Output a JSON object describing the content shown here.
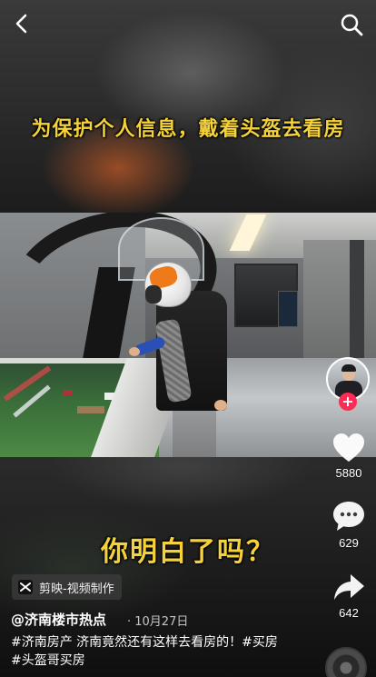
{
  "video": {
    "subtitle_top": "为保护个人信息，戴着头盔去看房",
    "subtitle_bottom": "你明白了吗？"
  },
  "header": {
    "back_icon": "back-chevron-icon",
    "search_icon": "search-icon"
  },
  "rail": {
    "avatar_icon": "avatar",
    "follow_icon": "plus-icon",
    "like_count": "5880",
    "comment_count": "629",
    "share_count": "642",
    "like_color": "#ffffff",
    "follow_color": "#fe2c55"
  },
  "info": {
    "capcut_label": "剪映-视频制作",
    "author": "@济南楼市热点",
    "date": "· 10月27日",
    "caption": "#济南房产 济南竟然还有这样去看房的！#买房 #头盔哥买房"
  }
}
